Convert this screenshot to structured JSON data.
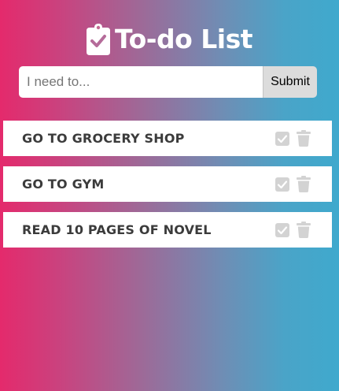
{
  "header": {
    "title": "To-do List",
    "icon": "clipboard-check-icon"
  },
  "form": {
    "input_placeholder": "I need to...",
    "input_value": "",
    "submit_label": "Submit"
  },
  "todos": [
    {
      "text": "Go to grocery shop",
      "completed": false
    },
    {
      "text": "Go to gym",
      "completed": false
    },
    {
      "text": "Read 10 pages of novel",
      "completed": false
    }
  ],
  "colors": {
    "gradient_left": "#e42a6c",
    "gradient_right": "#3fa9cd",
    "action_icon": "#d3d3d3",
    "item_text": "#3b3b3b"
  },
  "icons": {
    "complete": "check-square-icon",
    "delete": "trash-icon"
  }
}
